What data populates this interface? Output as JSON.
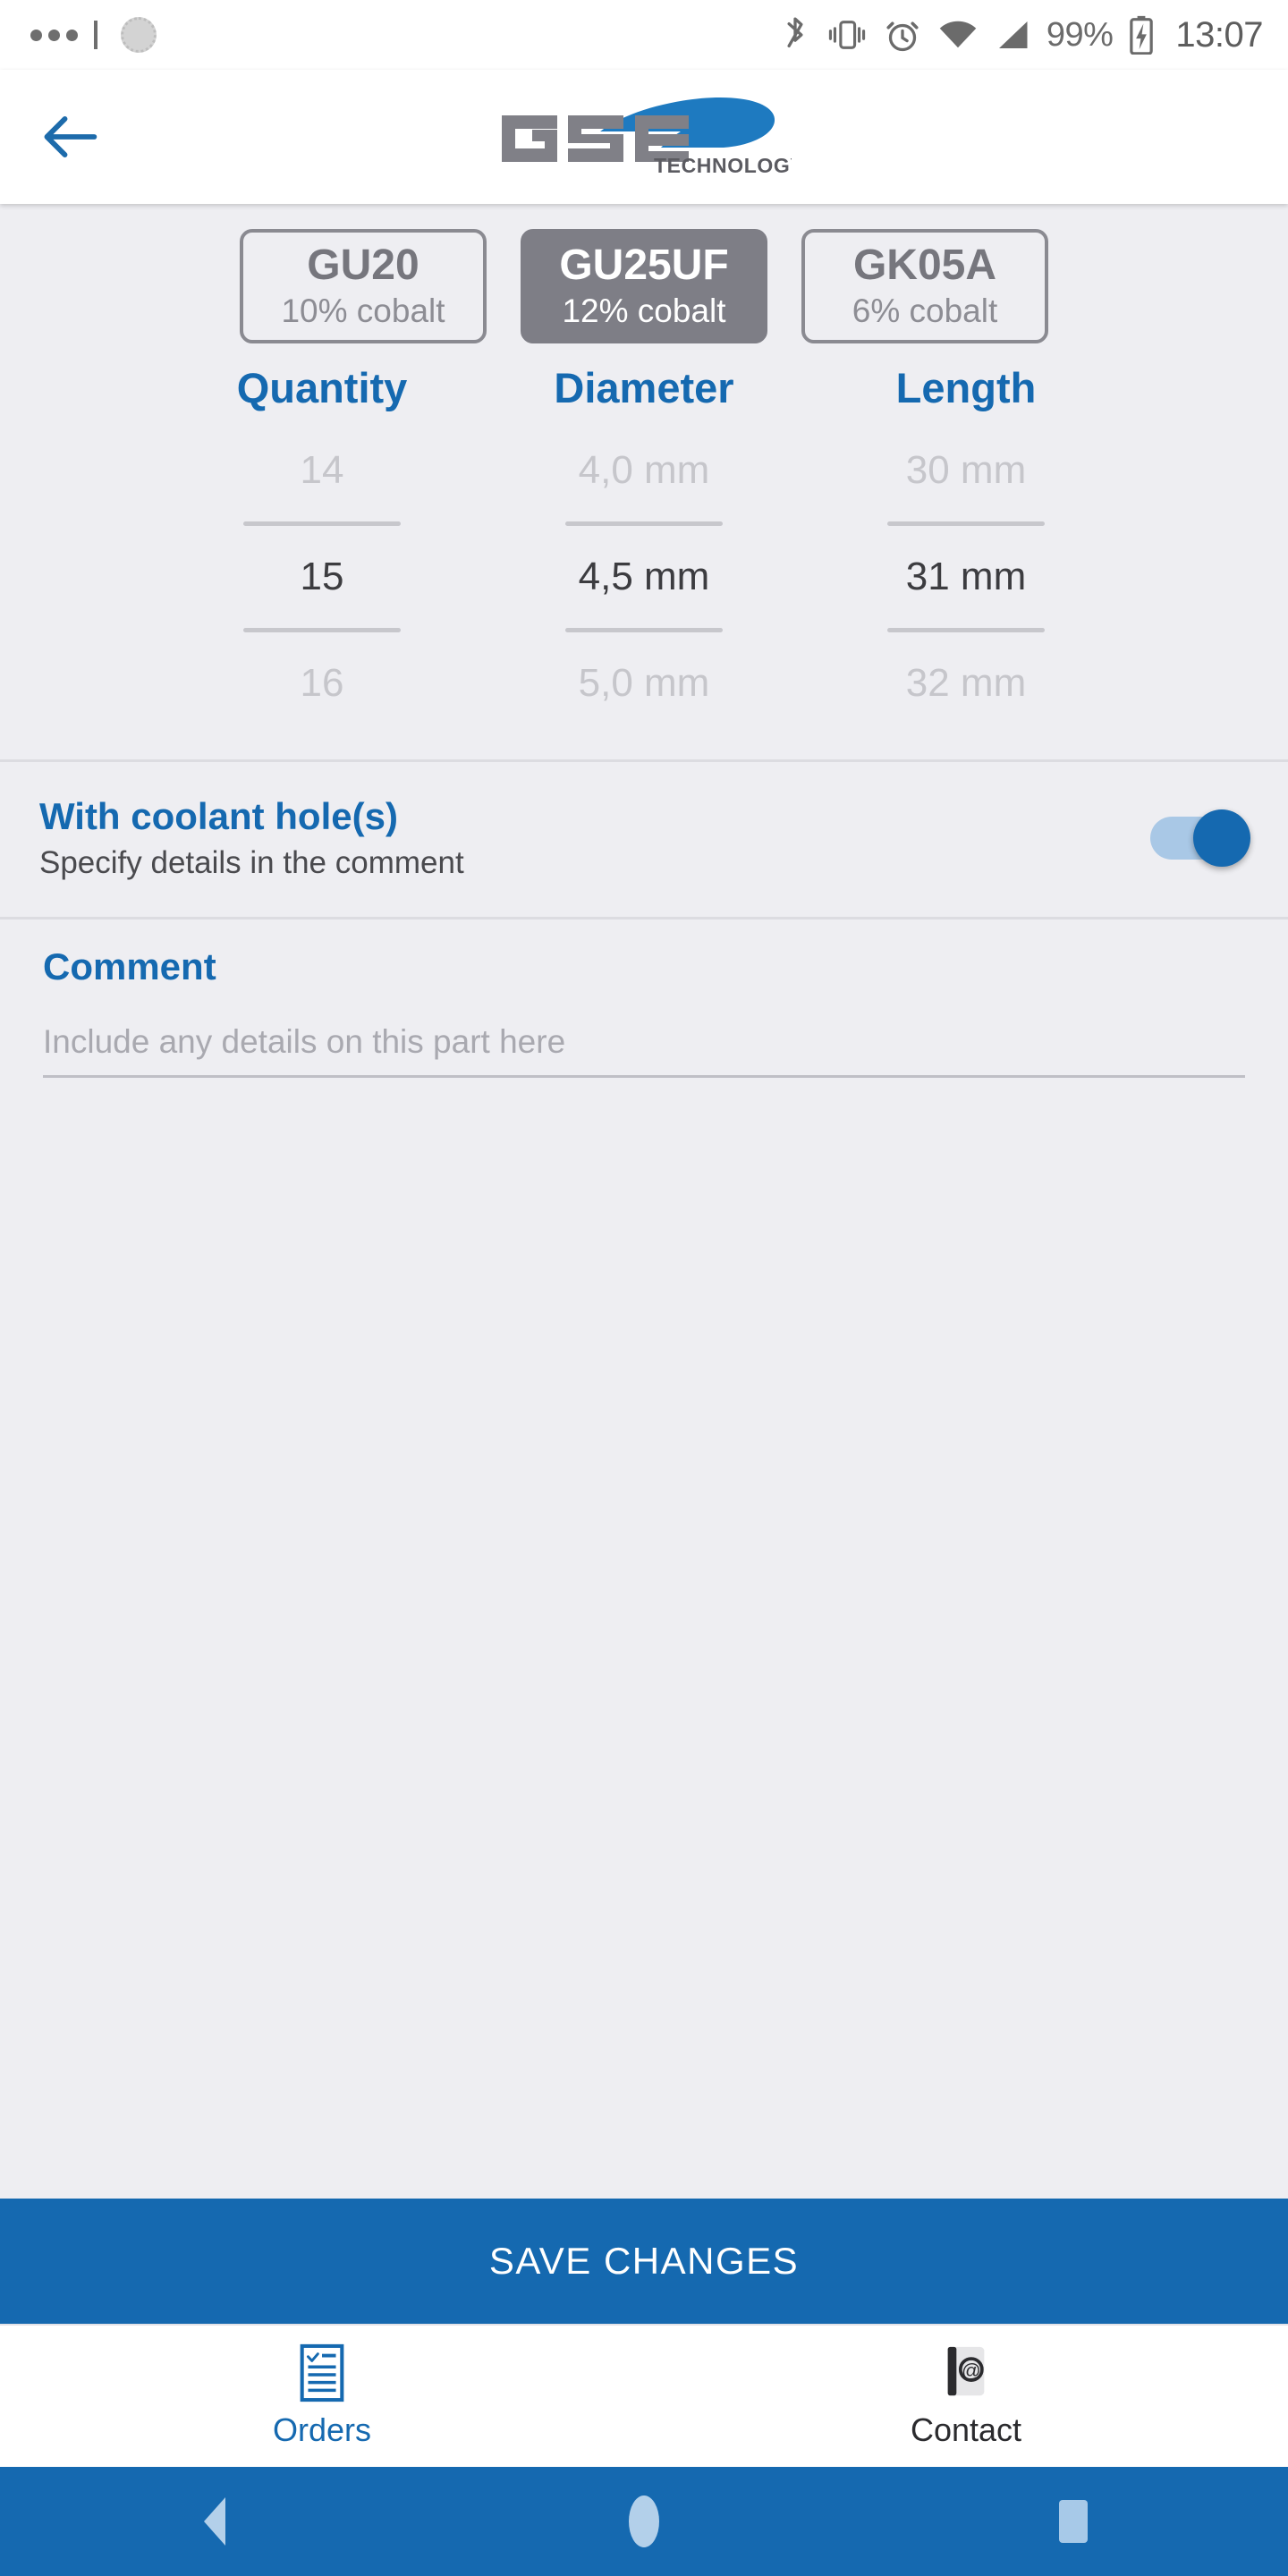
{
  "status_bar": {
    "notification_icons": [
      "dots-icon",
      "circle-notification-icon"
    ],
    "bluetooth": "bluetooth-icon",
    "vibrate": "vibrate-icon",
    "alarm": "alarm-icon",
    "wifi": "wifi-icon",
    "signal": "signal-icon",
    "battery_percent": "99%",
    "battery": "battery-charging-icon",
    "clock": "13:07"
  },
  "header": {
    "back_icon": "back-arrow-icon",
    "logo_primary": "GSE",
    "logo_secondary": "TECHNOLOGY"
  },
  "grades": [
    {
      "name": "GU20",
      "cobalt": "10% cobalt",
      "selected": false
    },
    {
      "name": "GU25UF",
      "cobalt": "12% cobalt",
      "selected": true
    },
    {
      "name": "GK05A",
      "cobalt": "6% cobalt",
      "selected": false
    }
  ],
  "pickers": [
    {
      "header": "Quantity",
      "previous": "14",
      "current": "15",
      "next": "16"
    },
    {
      "header": "Diameter",
      "previous": "4,0 mm",
      "current": "4,5 mm",
      "next": "5,0 mm"
    },
    {
      "header": "Length",
      "previous": "30 mm",
      "current": "31 mm",
      "next": "32 mm"
    }
  ],
  "coolant": {
    "title": "With coolant hole(s)",
    "subtitle": "Specify details in the comment",
    "enabled": true
  },
  "comment": {
    "label": "Comment",
    "value": "",
    "placeholder": "Include any details on this part here"
  },
  "save_button": {
    "label": "SAVE CHANGES"
  },
  "tabs": [
    {
      "label": "Orders",
      "icon": "orders-checklist-icon",
      "active": true
    },
    {
      "label": "Contact",
      "icon": "contact-card-icon",
      "active": false
    }
  ],
  "nav_bar": {
    "back": "nav-back-icon",
    "home": "nav-home-icon",
    "recents": "nav-recents-icon"
  },
  "colors": {
    "accent": "#1569b0",
    "selected_chip": "#7e7e86",
    "page_background": "#eeeef2"
  }
}
